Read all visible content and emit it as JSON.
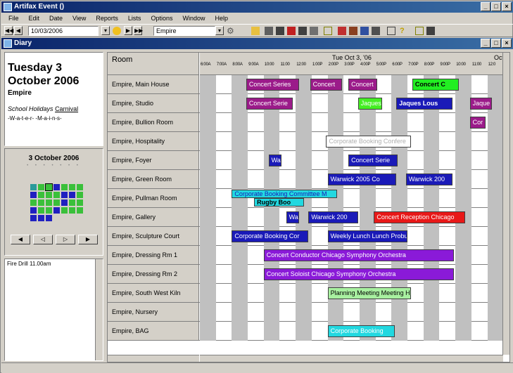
{
  "window": {
    "title": "Artifax Event ()",
    "controls": [
      "_",
      "□",
      "×"
    ]
  },
  "menu": [
    "File",
    "Edit",
    "Date",
    "View",
    "Reports",
    "Lists",
    "Options",
    "Window",
    "Help"
  ],
  "toolbar": {
    "date_value": "10/03/2006",
    "venue_value": "Empire"
  },
  "diary": {
    "title": "Diary",
    "controls": [
      "_",
      "□",
      "×"
    ],
    "day_line1": "Tuesday 3",
    "day_line2": "October 2006",
    "venue": "Empire",
    "holiday_prefix": "School Holidays",
    "holiday_link": "Carnival",
    "water": "-W-a-t-e-r- -M-a-i-n-s-",
    "mini_cal_caption": "3 October 2006",
    "notes_text": "Fire Drill 11.00am"
  },
  "grid": {
    "room_header": "Room",
    "date_header": "Tue Oct 3, '06",
    "date_header_next": "Oct",
    "hours": [
      "6:00A",
      "7:00A",
      "8:00A",
      "9:00A",
      "10:00",
      "11:00",
      "12:00",
      "1:00P",
      "2:00P",
      "3:00P",
      "4:00P",
      "5:00P",
      "6:00P",
      "7:00P",
      "8:00P",
      "9:00P",
      "10:00",
      "11:00",
      "12:0"
    ],
    "rooms": [
      "Empire, Main House",
      "Empire, Studio",
      "Empire, Bullion Room",
      "Empire, Hospitality",
      "Empire, Foyer",
      "Empire, Green Room",
      "Empire, Pullman Room",
      "Empire, Gallery",
      "Empire, Sculpture Court",
      "Empire, Dressing Rm 1",
      "Empire, Dressing Rm 2",
      "Empire, South West Kiln",
      "Empire, Nursery",
      "Empire, BAG"
    ],
    "events": [
      {
        "row": 0,
        "start": 2.9,
        "end": 6.2,
        "label": "Concert Series",
        "color": "#9b1b8a",
        "text": "#ffffff",
        "bold": false
      },
      {
        "row": 0,
        "start": 6.9,
        "end": 8.9,
        "label": "Concert",
        "color": "#9b1b8a",
        "text": "#ffffff",
        "bold": false
      },
      {
        "row": 0,
        "start": 9.3,
        "end": 11.1,
        "label": "Concert",
        "color": "#9b1b8a",
        "text": "#ffffff",
        "bold": false
      },
      {
        "row": 0,
        "start": 13.3,
        "end": 16.2,
        "label": "Concert C",
        "color": "#22ee22",
        "text": "#000000",
        "bold": true
      },
      {
        "row": 1,
        "start": 2.9,
        "end": 5.8,
        "label": "Concert Serie",
        "color": "#9b1b8a",
        "text": "#ffffff",
        "bold": false
      },
      {
        "row": 1,
        "start": 9.9,
        "end": 11.4,
        "label": "Jaques L",
        "color": "#44ee22",
        "text": "#ffffff",
        "bold": false
      },
      {
        "row": 1,
        "start": 12.3,
        "end": 15.8,
        "label": "Jaques Lous",
        "color": "#1a1ab8",
        "text": "#ffffff",
        "bold": true
      },
      {
        "row": 1,
        "start": 16.9,
        "end": 18.3,
        "label": "Jaque",
        "color": "#9b1b8a",
        "text": "#ffffff",
        "bold": false
      },
      {
        "row": 2,
        "start": 16.9,
        "end": 17.9,
        "label": "Cor",
        "color": "#9b1b8a",
        "text": "#ffffff",
        "bold": false
      },
      {
        "row": 3,
        "start": 7.9,
        "end": 13.2,
        "label": "Corporate Booking Confere",
        "color": "#ffffff",
        "text": "#b0b0b0",
        "bold": false
      },
      {
        "row": 4,
        "start": 4.3,
        "end": 5.1,
        "label": "Warw",
        "color": "#1a1ab8",
        "text": "#ffffff",
        "bold": false
      },
      {
        "row": 4,
        "start": 9.3,
        "end": 12.4,
        "label": "Concert Serie",
        "color": "#1a1ab8",
        "text": "#ffffff",
        "bold": false
      },
      {
        "row": 5,
        "start": 8.0,
        "end": 12.3,
        "label": "Warwick 2005 Co",
        "color": "#1a1ab8",
        "text": "#ffffff",
        "bold": false
      },
      {
        "row": 5,
        "start": 12.9,
        "end": 15.8,
        "label": "Warwick 200",
        "color": "#1a1ab8",
        "text": "#ffffff",
        "bold": false
      },
      {
        "row": 6,
        "start": 2.0,
        "end": 8.6,
        "label": "Corporate Booking Committee M",
        "color": "#22d8e0",
        "text": "#1a1ab8",
        "bold": false,
        "half": "top"
      },
      {
        "row": 6,
        "start": 3.4,
        "end": 6.5,
        "label": "Rugby Boo",
        "color": "#22d8e0",
        "text": "#000000",
        "bold": true,
        "half": "bottom"
      },
      {
        "row": 7,
        "start": 5.4,
        "end": 6.2,
        "label": "Warw",
        "color": "#1a1ab8",
        "text": "#ffffff",
        "bold": false
      },
      {
        "row": 7,
        "start": 6.8,
        "end": 9.9,
        "label": "Warwick 200",
        "color": "#1a1ab8",
        "text": "#ffffff",
        "bold": false
      },
      {
        "row": 7,
        "start": 10.9,
        "end": 16.6,
        "label": "Concert Reception Chicago",
        "color": "#e81818",
        "text": "#ffffff",
        "bold": false
      },
      {
        "row": 8,
        "start": 2.0,
        "end": 6.8,
        "label": "Corporate Booking Cor",
        "color": "#1a1ab8",
        "text": "#ffffff",
        "bold": false
      },
      {
        "row": 8,
        "start": 8.0,
        "end": 13.0,
        "label": "Weekly Lunch Lunch Probus",
        "color": "#1a1ab8",
        "text": "#ffffff",
        "bold": false
      },
      {
        "row": 9,
        "start": 4.0,
        "end": 15.9,
        "label": "Concert Conductor Chicago Symphony Orchestra",
        "color": "#8a1ad8",
        "text": "#ffffff",
        "bold": false
      },
      {
        "row": 10,
        "start": 4.0,
        "end": 15.9,
        "label": "Concert Soloist Chicago Symphony Orchestra",
        "color": "#8a1ad8",
        "text": "#ffffff",
        "bold": false
      },
      {
        "row": 11,
        "start": 8.0,
        "end": 13.2,
        "label": "Planning Meeting Meeting Ha",
        "color": "#a8f0a0",
        "text": "#000000",
        "bold": false
      },
      {
        "row": 13,
        "start": 8.0,
        "end": 12.2,
        "label": "Corporate Booking",
        "color": "#22d8e0",
        "text": "#ffffff",
        "bold": false
      }
    ]
  }
}
